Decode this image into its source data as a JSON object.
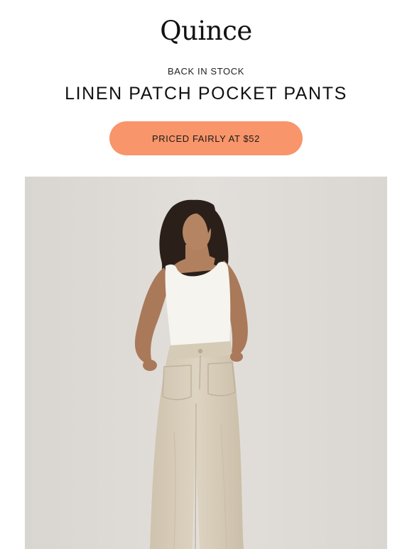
{
  "brand": {
    "logo_text": "Quince"
  },
  "hero_copy": {
    "eyebrow": "BACK IN STOCK",
    "headline": "LINEN PATCH POCKET PANTS"
  },
  "cta": {
    "label": "PRICED FAIRLY AT $52"
  },
  "colors": {
    "cta_background": "#f8956a",
    "hero_background": "#dcd8d4",
    "pants": "#d8cdb9",
    "tank_top": "#f6f4ef",
    "hair": "#2b1f1a",
    "skin": "#a9795a"
  },
  "hero_image": {
    "subject": "model-wearing-linen-pants"
  }
}
